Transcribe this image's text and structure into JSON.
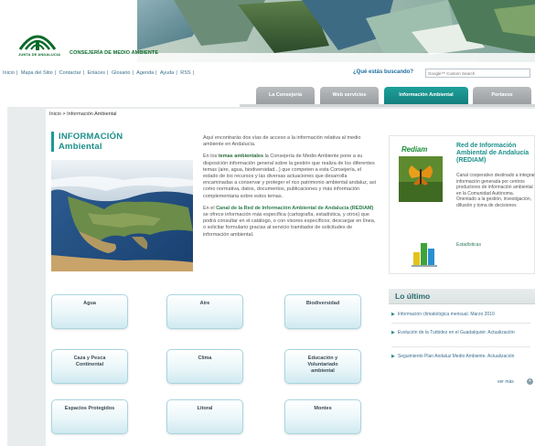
{
  "header": {
    "logo_small_text": "JUNTA DE ANDALUCIA",
    "logo_name": "CONSEJERÍA DE MEDIO AMBIENTE"
  },
  "utility_nav": {
    "links": [
      "Inicio",
      "Mapa del Sitio",
      "Contactar",
      "Enlaces",
      "Glosario",
      "Agenda",
      "Ayuda",
      "RSS"
    ],
    "search_label": "¿Qué estás buscando?",
    "search_placeholder": "Google™ Custom Search"
  },
  "tabs": [
    {
      "label": "La Consejería",
      "active": false
    },
    {
      "label": "Web servicios",
      "active": false
    },
    {
      "label": "Información Ambiental",
      "active": true
    },
    {
      "label": "Portavoz",
      "active": false
    }
  ],
  "breadcrumb": "Inicio > Información Ambiental",
  "section_title": {
    "line1": "INFORMACIÓN",
    "line2": "Ambiental"
  },
  "intro": {
    "p1": "Aquí encontrarás dos vías de acceso a la información relativa al medio ambiente en Andalucía.",
    "p2_pre": "En los ",
    "p2_bold": "temas ambientales",
    "p2_post": " la Consejería de Medio Ambiente pone a su disposición información general sobre la gestión que realiza de los diferentes temas (aire, agua, biodiversidad...) que competen a esta Consejería, el estado de los recursos y las diversas actuaciones que desarrolla encaminadas a conservar y proteger el rico patrimonio ambiental andaluz, así como normativa, datos, documentos, publicaciones y más información complementaria sobre estos temas.",
    "p3_pre": "En el ",
    "p3_bold": "Canal de la Red de Información Ambiental de Andalucía (REDIAM)",
    "p3_post": " se ofrece información más específica (cartografía, estadística, y otros) que podrá consultar en el catálogo, o con visores específicos; descargar en línea, o solicitar formulario gracias al servicio tramitador de solicitudes de información ambiental."
  },
  "categories": [
    {
      "label": "Agua"
    },
    {
      "label": "Aire"
    },
    {
      "label": "Biodiversidad"
    },
    {
      "label": "Caza y Pesca Continental"
    },
    {
      "label": "Clima"
    },
    {
      "label": "Educación y Voluntariado ambiental"
    },
    {
      "label": "Espacios Protegidos"
    },
    {
      "label": "Litoral"
    },
    {
      "label": "Montes"
    }
  ],
  "sidebar": {
    "rediam_logo": "Rediam",
    "rediam_title": "Red de Información Ambiental de Andalucía (REDIAM)",
    "rediam_desc": "Canal cooperativo destinado a integrar información generada por centros productores de información ambiental en la Comunidad Autónoma. Orientado a la gestión, investigación, difusión y toma de decisiones",
    "stats_label": "Estadísticas",
    "lo_ultimo": "Lo último",
    "news": [
      "Información climatológica mensual. Marzo 2010",
      "Evolución de la Turbidez en el Guadalquivir. Actualización",
      "Seguimiento Plan Andaluz Medio Ambiente. Actualización"
    ],
    "ver_mas": "ver más"
  },
  "colors": {
    "accent": "#1c9a94",
    "tab_inactive": "#a8acae",
    "brand_green": "#0a6a2a"
  }
}
